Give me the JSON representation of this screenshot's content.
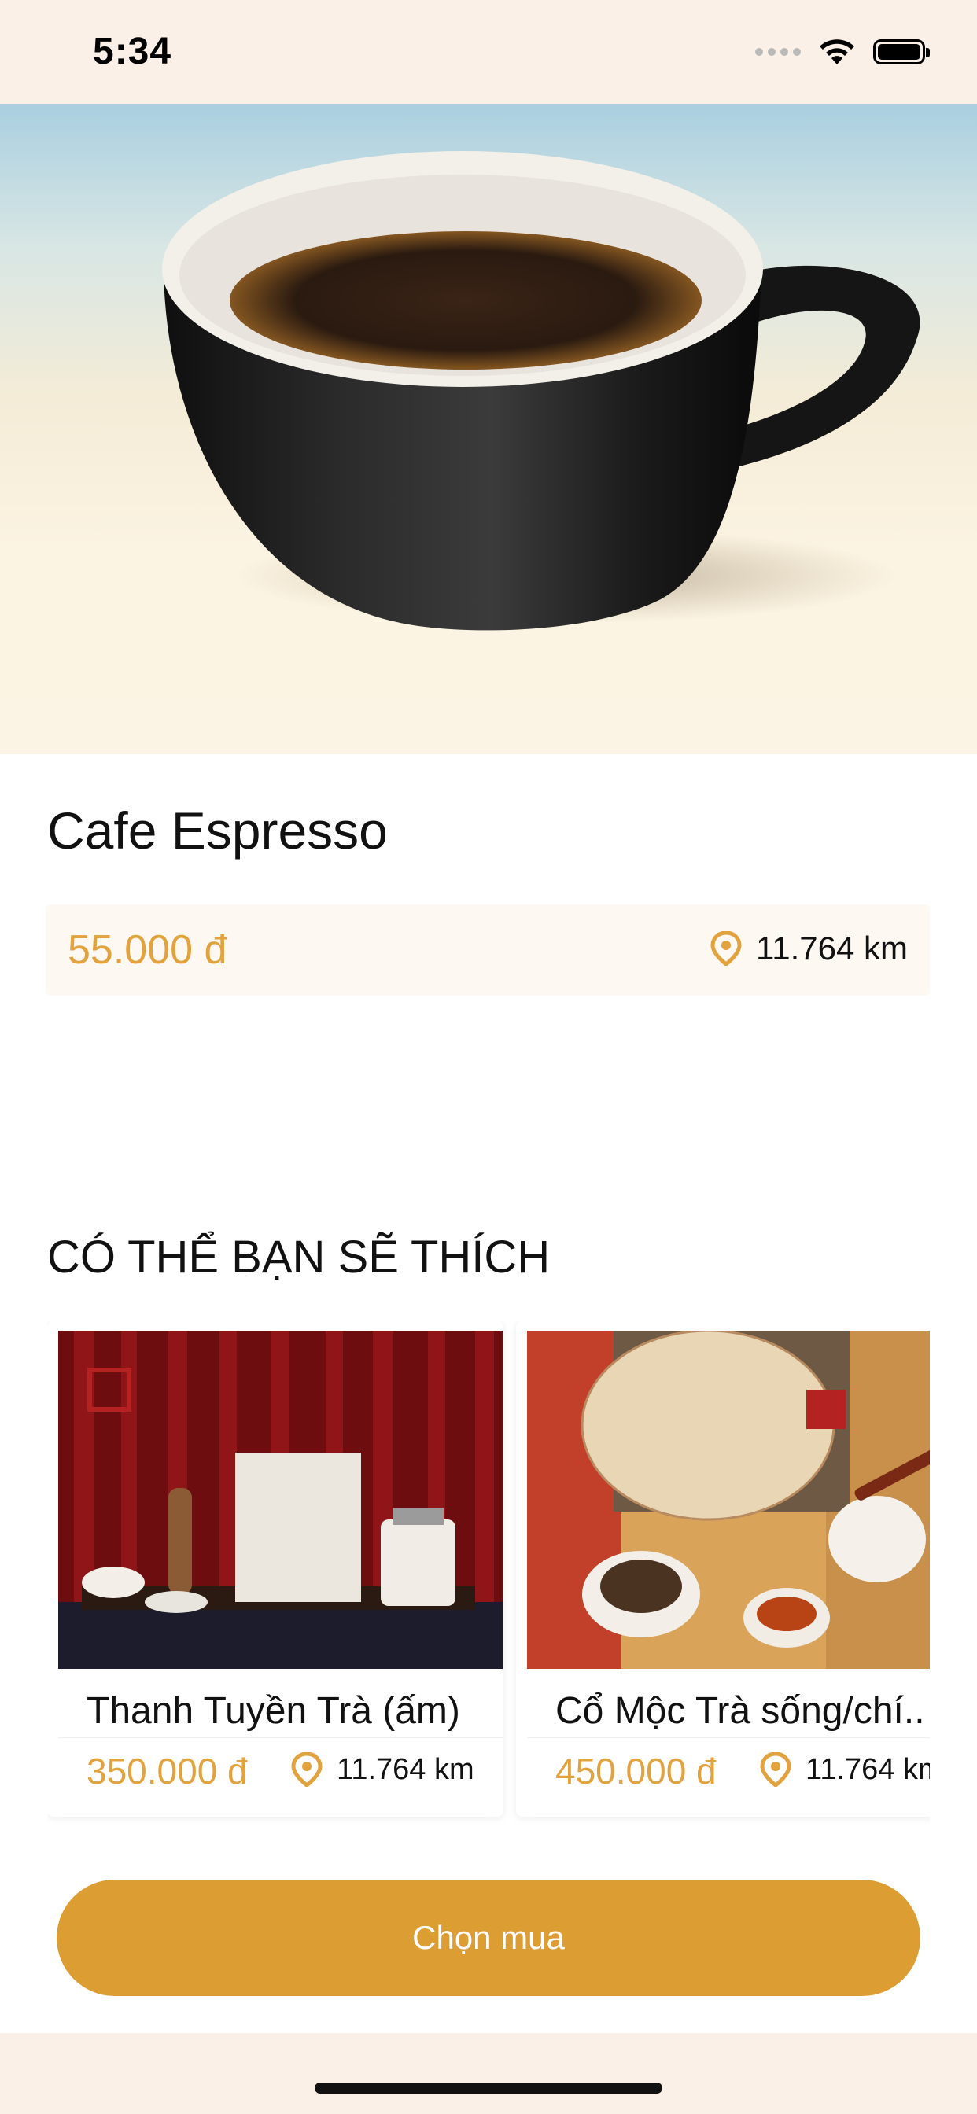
{
  "status_bar": {
    "time": "5:34"
  },
  "product": {
    "name": "Cafe Espresso",
    "price": "55.000 đ",
    "distance": "11.764 km"
  },
  "suggestions": {
    "title": "CÓ THỂ BẠN SẼ THÍCH",
    "items": [
      {
        "name": "Thanh Tuyền Trà (ấm)",
        "price": "350.000 đ",
        "distance": "11.764 km"
      },
      {
        "name": "Cổ Mộc Trà sống/chí..",
        "price": "450.000 đ",
        "distance": "11.764 km"
      }
    ]
  },
  "actions": {
    "buy_label": "Chọn mua"
  },
  "colors": {
    "accent": "#dc9d32",
    "price": "#e2a23e",
    "status_bg": "#fbf0e7"
  },
  "icons": [
    "location-pin-icon",
    "wifi-icon",
    "battery-icon",
    "signal-icon"
  ]
}
